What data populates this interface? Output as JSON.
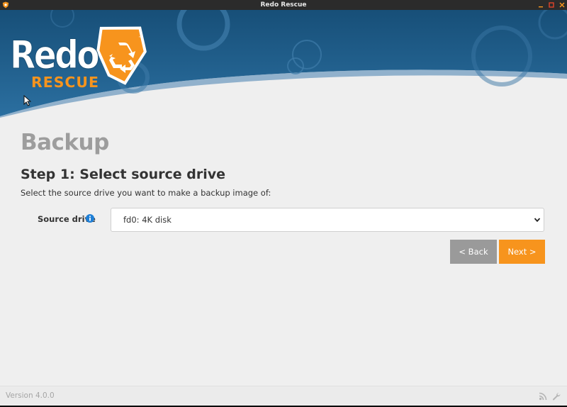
{
  "window": {
    "title": "Redo Rescue"
  },
  "logo": {
    "word": "Redo",
    "subword": "RESCUE",
    "mark": "™"
  },
  "page": {
    "title": "Backup",
    "step_title": "Step 1: Select source drive",
    "step_description": "Select the source drive you want to make a backup image of:"
  },
  "form": {
    "source_label": "Source drive",
    "source_value": "fd0: 4K disk"
  },
  "buttons": {
    "back": "< Back",
    "next": "Next >"
  },
  "status": {
    "version": "Version 4.0.0"
  },
  "colors": {
    "accent": "#f7941d",
    "header_blue": "#1f5f8b",
    "info_blue": "#1f7fd6"
  }
}
